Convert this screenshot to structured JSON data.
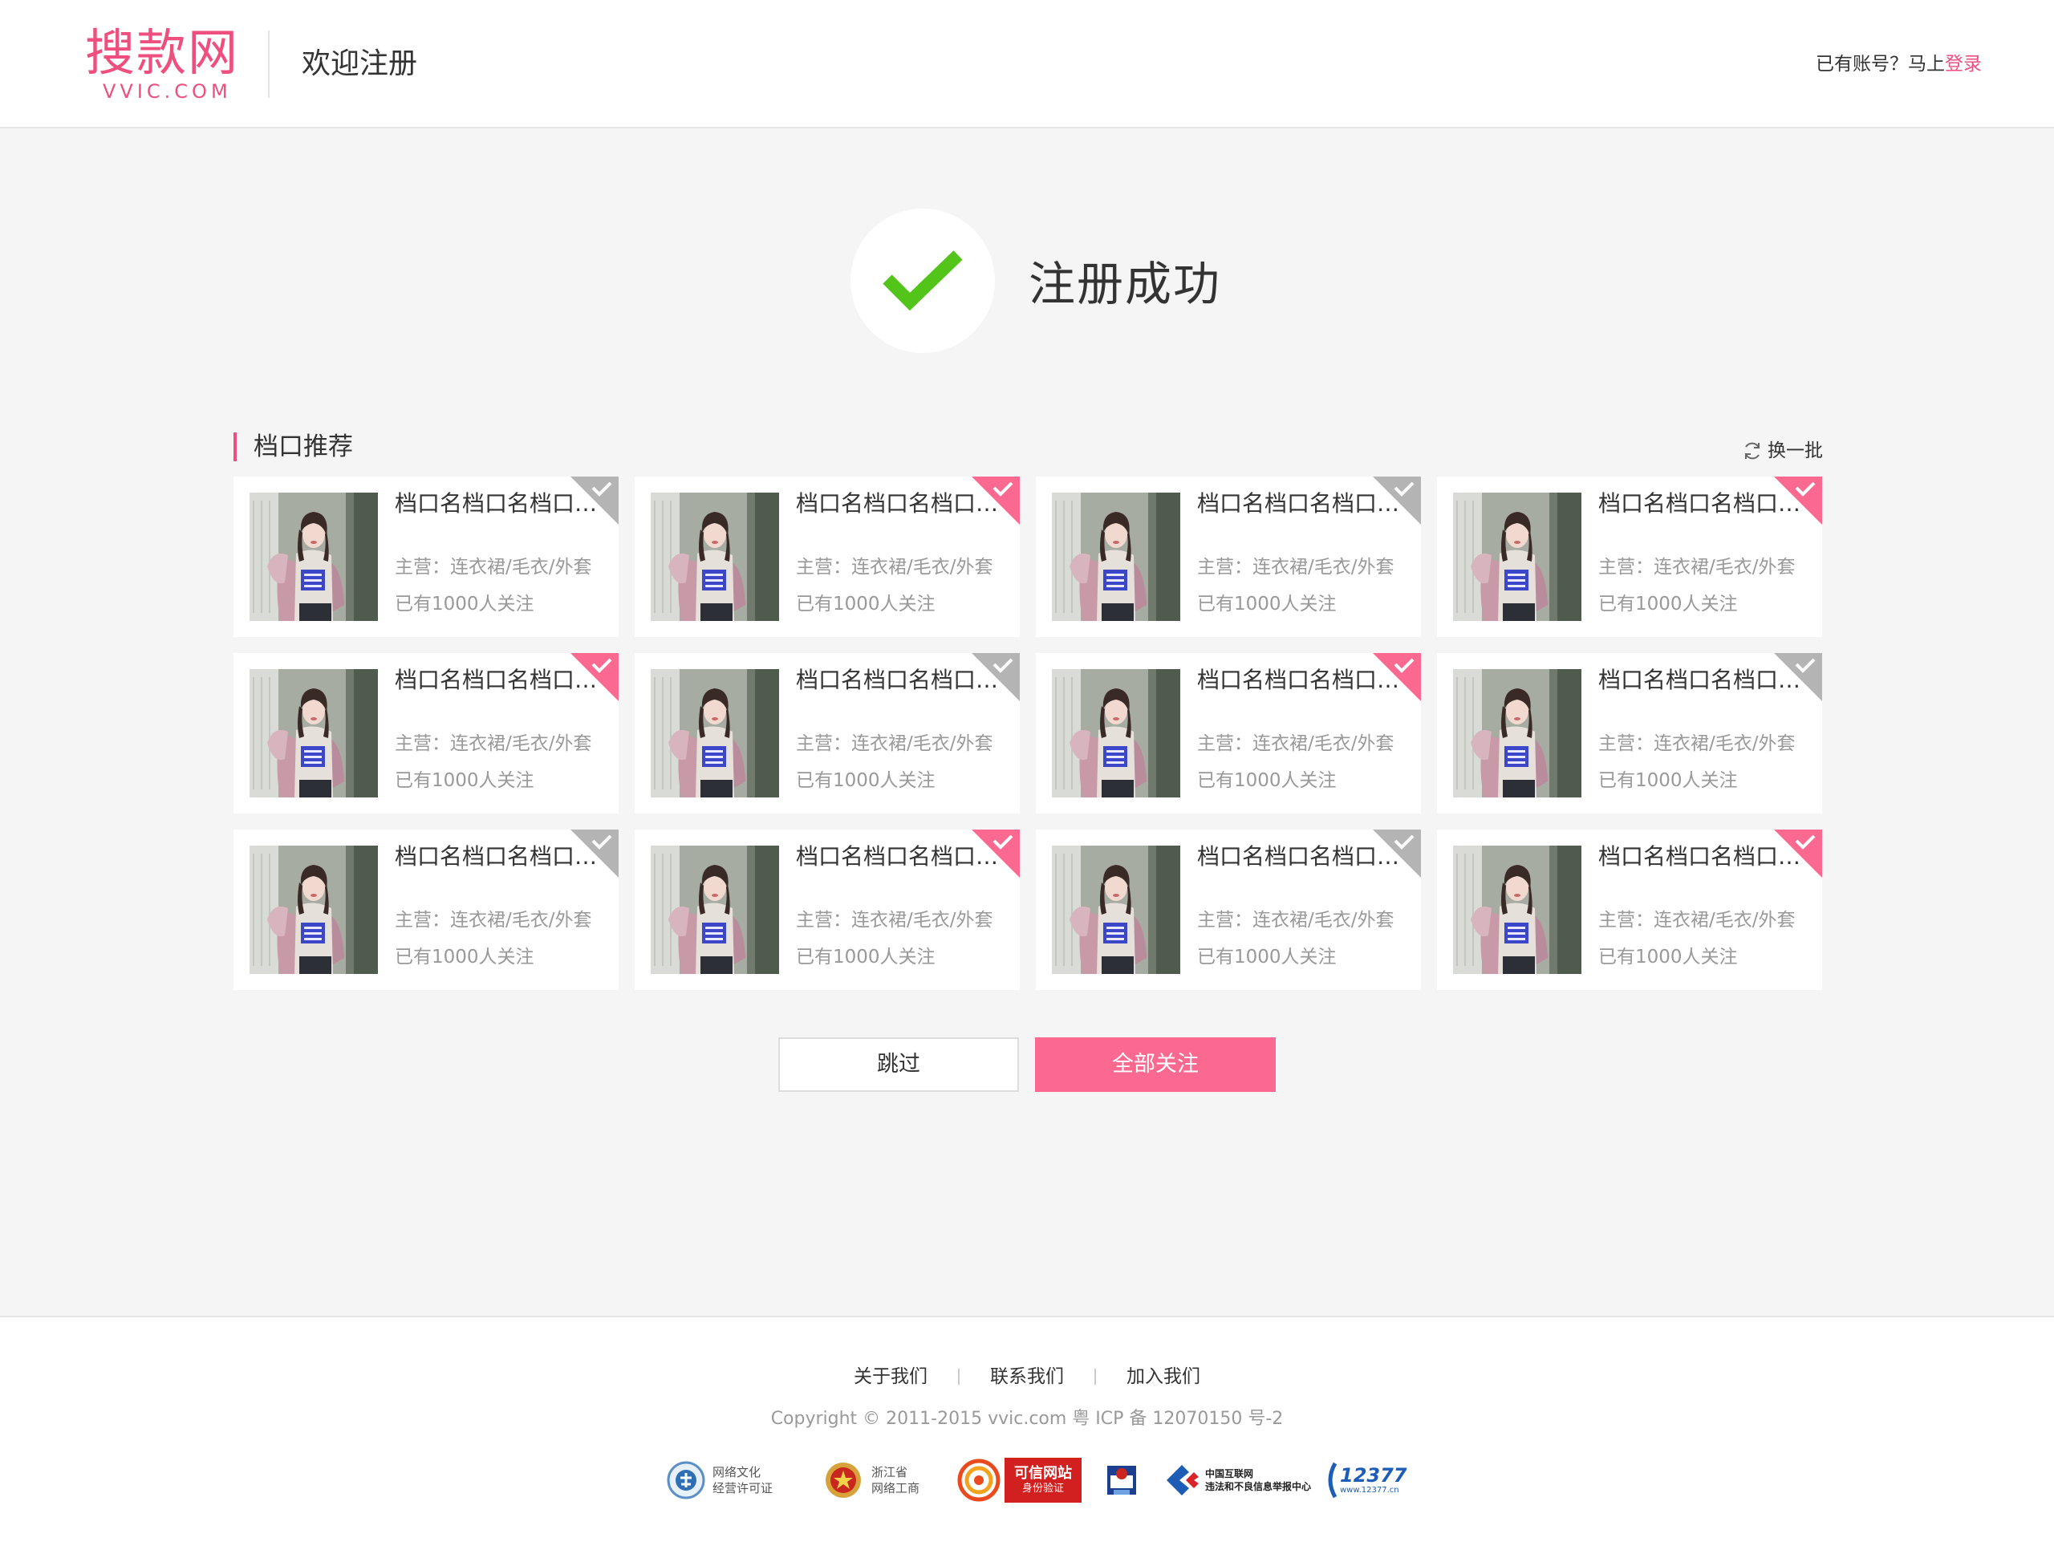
{
  "header": {
    "logo_cn": "搜款网",
    "logo_en": "VVIC.COM",
    "title": "欢迎注册",
    "login_prompt": "已有账号？马上",
    "login_link": "登录"
  },
  "success": {
    "text": "注册成功"
  },
  "section": {
    "title": "档口推荐",
    "refresh_label": "换一批"
  },
  "stores": [
    {
      "name": "档口名档口名档口名档口名",
      "main": "主营：连衣裙/毛衣/外套",
      "followers": "已有1000人关注",
      "selected": false
    },
    {
      "name": "档口名档口名档口名档口名",
      "main": "主营：连衣裙/毛衣/外套",
      "followers": "已有1000人关注",
      "selected": true
    },
    {
      "name": "档口名档口名档口名档口名",
      "main": "主营：连衣裙/毛衣/外套",
      "followers": "已有1000人关注",
      "selected": false
    },
    {
      "name": "档口名档口名档口名档口名",
      "main": "主营：连衣裙/毛衣/外套",
      "followers": "已有1000人关注",
      "selected": true
    },
    {
      "name": "档口名档口名档口名档口名",
      "main": "主营：连衣裙/毛衣/外套",
      "followers": "已有1000人关注",
      "selected": true
    },
    {
      "name": "档口名档口名档口名档口名",
      "main": "主营：连衣裙/毛衣/外套",
      "followers": "已有1000人关注",
      "selected": false
    },
    {
      "name": "档口名档口名档口名档口名",
      "main": "主营：连衣裙/毛衣/外套",
      "followers": "已有1000人关注",
      "selected": true
    },
    {
      "name": "档口名档口名档口名档口名",
      "main": "主营：连衣裙/毛衣/外套",
      "followers": "已有1000人关注",
      "selected": false
    },
    {
      "name": "档口名档口名档口名档口名",
      "main": "主营：连衣裙/毛衣/外套",
      "followers": "已有1000人关注",
      "selected": false
    },
    {
      "name": "档口名档口名档口名档口名",
      "main": "主营：连衣裙/毛衣/外套",
      "followers": "已有1000人关注",
      "selected": true
    },
    {
      "name": "档口名档口名档口名档口名",
      "main": "主营：连衣裙/毛衣/外套",
      "followers": "已有1000人关注",
      "selected": false
    },
    {
      "name": "档口名档口名档口名档口名",
      "main": "主营：连衣裙/毛衣/外套",
      "followers": "已有1000人关注",
      "selected": true
    }
  ],
  "buttons": {
    "skip": "跳过",
    "follow_all": "全部关注"
  },
  "footer": {
    "links": [
      "关于我们",
      "联系我们",
      "加入我们"
    ],
    "copyright": "Copyright © 2011-2015 vvic.com 粤 ICP 备 12070150 号-2",
    "badges": {
      "culture": [
        "网络文化",
        "经营许可证"
      ],
      "aic": [
        "浙江省",
        "网络工商"
      ],
      "trusted": [
        "可信网站",
        "身份验证"
      ],
      "report": [
        "中国互联网",
        "违法和不良信息举报中心"
      ],
      "hotline": "12377",
      "hotline_url": "www.12377.cn"
    }
  },
  "colors": {
    "accent": "#ee4f7f",
    "button_pink": "#fb6890",
    "check_green": "#52c41a",
    "corner_gray": "#b4b4b4"
  }
}
